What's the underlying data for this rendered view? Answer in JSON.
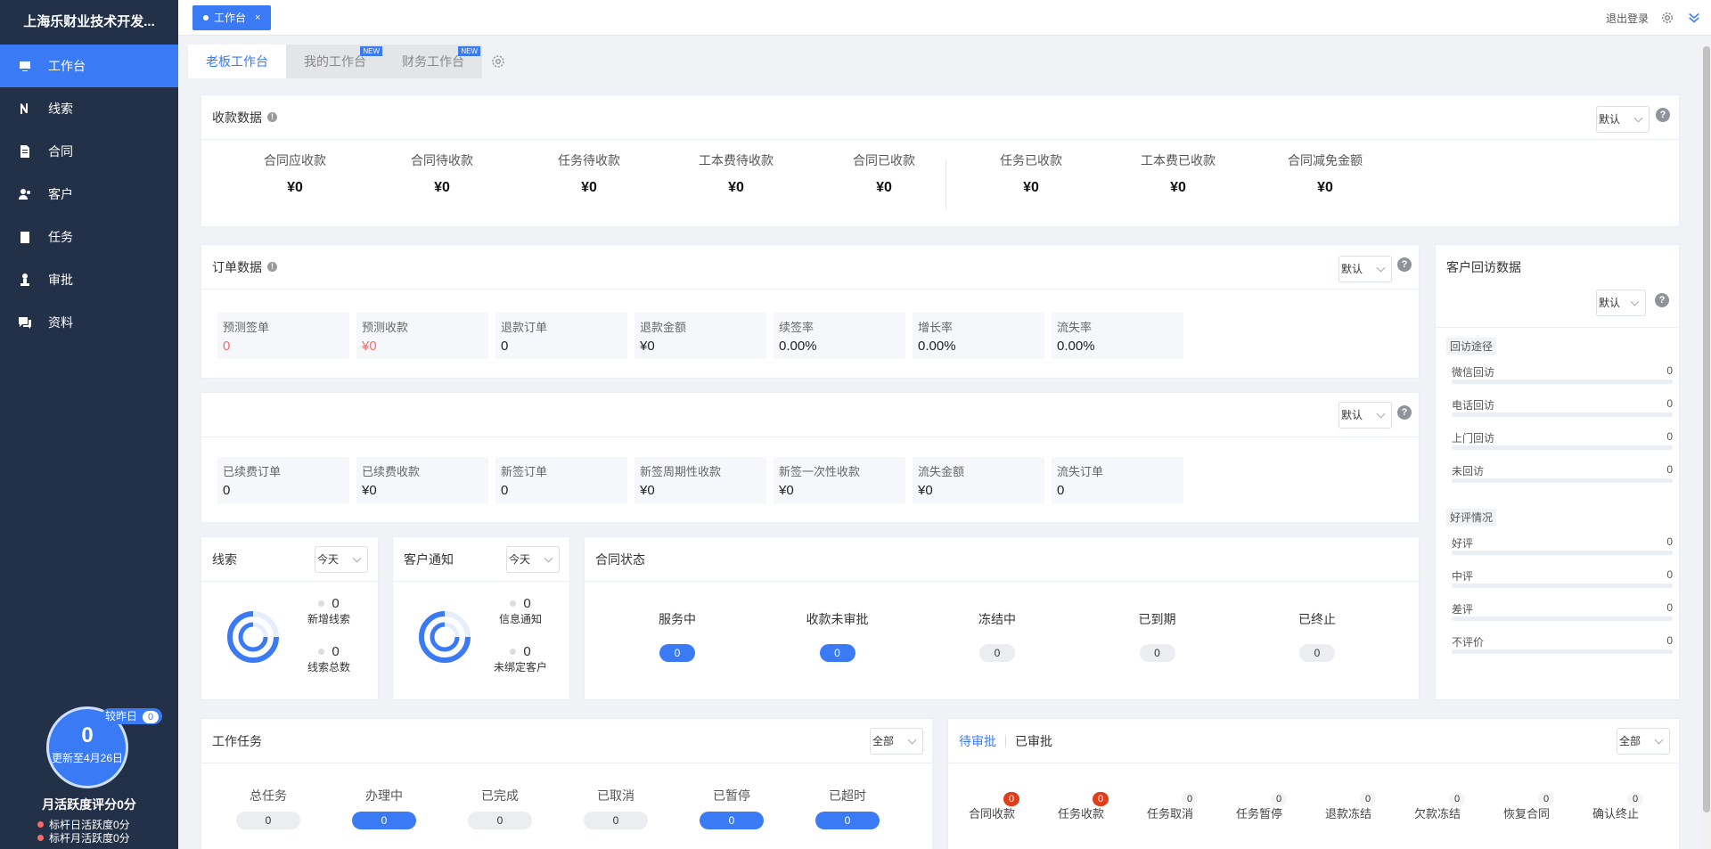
{
  "brand": "上海乐财业技术开发...",
  "nav": [
    {
      "label": "工作台",
      "icon": "dashboard-icon"
    },
    {
      "label": "线索",
      "icon": "clue-icon"
    },
    {
      "label": "合同",
      "icon": "contract-icon"
    },
    {
      "label": "客户",
      "icon": "customer-icon"
    },
    {
      "label": "任务",
      "icon": "task-icon"
    },
    {
      "label": "审批",
      "icon": "approval-icon"
    },
    {
      "label": "资料",
      "icon": "data-icon"
    }
  ],
  "activity": {
    "score": "0",
    "updated": "更新至4月26日",
    "compare_label": "较昨日",
    "compare_value": "0",
    "title": "月活跃度评分0分",
    "line1": "标杆日活跃度0分",
    "line2": "标杆月活跃度0分"
  },
  "page_tab": {
    "label": "工作台",
    "close": "×"
  },
  "topbar": {
    "logout": "退出登录"
  },
  "tabs": [
    {
      "label": "老板工作台",
      "new": ""
    },
    {
      "label": "我的工作台",
      "new": "NEW"
    },
    {
      "label": "财务工作台",
      "new": "NEW"
    }
  ],
  "collection": {
    "title": "收款数据",
    "select": "默认",
    "help": "?",
    "items": [
      {
        "label": "合同应收款",
        "value": "¥0"
      },
      {
        "label": "合同待收款",
        "value": "¥0"
      },
      {
        "label": "任务待收款",
        "value": "¥0"
      },
      {
        "label": "工本费待收款",
        "value": "¥0"
      },
      {
        "label": "合同已收款",
        "value": "¥0"
      },
      {
        "label": "任务已收款",
        "value": "¥0"
      },
      {
        "label": "工本费已收款",
        "value": "¥0"
      },
      {
        "label": "合同减免金额",
        "value": "¥0"
      }
    ]
  },
  "orders": {
    "title": "订单数据",
    "select": "默认",
    "help": "?",
    "items": [
      {
        "label": "预测签单",
        "value": "0"
      },
      {
        "label": "预测收款",
        "value": "¥0"
      },
      {
        "label": "退款订单",
        "value": "0"
      },
      {
        "label": "退款金额",
        "value": "¥0"
      },
      {
        "label": "续签率",
        "value": "0.00%"
      },
      {
        "label": "增长率",
        "value": "0.00%"
      },
      {
        "label": "流失率",
        "value": "0.00%"
      }
    ]
  },
  "renew": {
    "select": "默认",
    "help": "?",
    "items": [
      {
        "label": "已续费订单",
        "value": "0"
      },
      {
        "label": "已续费收款",
        "value": "¥0"
      },
      {
        "label": "新签订单",
        "value": "0"
      },
      {
        "label": "新签周期性收款",
        "value": "¥0"
      },
      {
        "label": "新签一次性收款",
        "value": "¥0"
      },
      {
        "label": "流失金额",
        "value": "¥0"
      },
      {
        "label": "流失订单",
        "value": "0"
      }
    ]
  },
  "clues": {
    "title": "线索",
    "select": "今天",
    "v1": "0",
    "l1": "新增线索",
    "v2": "0",
    "l2": "线索总数"
  },
  "notice": {
    "title": "客户通知",
    "select": "今天",
    "v1": "0",
    "l1": "信息通知",
    "v2": "0",
    "l2": "未绑定客户"
  },
  "contract_status": {
    "title": "合同状态",
    "items": [
      {
        "label": "服务中",
        "value": "0",
        "style": "blue"
      },
      {
        "label": "收款未审批",
        "value": "0",
        "style": "blue"
      },
      {
        "label": "冻结中",
        "value": "0",
        "style": "grey"
      },
      {
        "label": "已到期",
        "value": "0",
        "style": "grey"
      },
      {
        "label": "已终止",
        "value": "0",
        "style": "grey"
      }
    ]
  },
  "revisit": {
    "title": "客户回访数据",
    "select": "默认",
    "help": "?",
    "sec1": "回访途径",
    "rows1": [
      {
        "label": "微信回访",
        "value": "0"
      },
      {
        "label": "电话回访",
        "value": "0"
      },
      {
        "label": "上门回访",
        "value": "0"
      },
      {
        "label": "未回访",
        "value": "0"
      }
    ],
    "sec2": "好评情况",
    "rows2": [
      {
        "label": "好评",
        "value": "0"
      },
      {
        "label": "中评",
        "value": "0"
      },
      {
        "label": "差评",
        "value": "0"
      },
      {
        "label": "不评价",
        "value": "0"
      }
    ]
  },
  "work_tasks": {
    "title": "工作任务",
    "select": "全部",
    "items": [
      {
        "label": "总任务",
        "value": "0",
        "style": "grey"
      },
      {
        "label": "办理中",
        "value": "0",
        "style": "blue"
      },
      {
        "label": "已完成",
        "value": "0",
        "style": "grey"
      },
      {
        "label": "已取消",
        "value": "0",
        "style": "grey"
      },
      {
        "label": "已暂停",
        "value": "0",
        "style": "blue"
      },
      {
        "label": "已超时",
        "value": "0",
        "style": "blue"
      }
    ]
  },
  "approvals": {
    "tab1": "待审批",
    "tab2": "已审批",
    "select": "全部",
    "items": [
      {
        "label": "合同收款",
        "count": "0",
        "style": "red"
      },
      {
        "label": "任务收款",
        "count": "0",
        "style": "red"
      },
      {
        "label": "任务取消",
        "count": "0",
        "style": "plain"
      },
      {
        "label": "任务暂停",
        "count": "0",
        "style": "plain"
      },
      {
        "label": "退款冻结",
        "count": "0",
        "style": "plain"
      },
      {
        "label": "欠款冻结",
        "count": "0",
        "style": "plain"
      },
      {
        "label": "恢复合同",
        "count": "0",
        "style": "plain"
      },
      {
        "label": "确认终止",
        "count": "0",
        "style": "plain"
      }
    ]
  }
}
